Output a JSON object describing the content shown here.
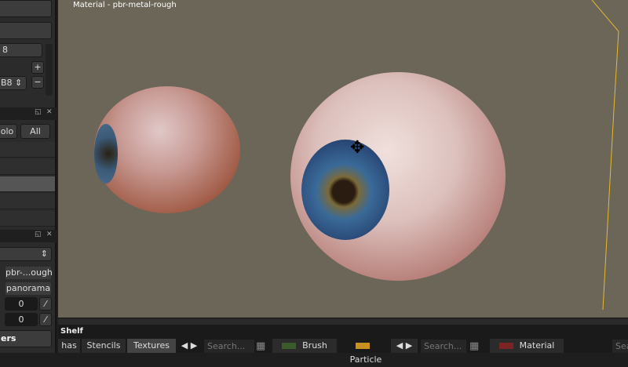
{
  "viewport": {
    "title": "Material - pbr-metal-rough"
  },
  "left_panel": {
    "format_value": "8",
    "format2_value": "B8",
    "solo_label": "olo",
    "all_label": "All",
    "shader_value": "pbr-...ough",
    "env_value": "panorama",
    "field1": "0",
    "field2": "0",
    "section_label": "ers"
  },
  "shelf": {
    "title": "Shelf",
    "tabs": [
      "has",
      "Stencils",
      "Textures"
    ],
    "search_placeholder": "Search...",
    "brush_label": "Brush",
    "particle_label": "Particle",
    "material_label": "Material",
    "search3": "Sea"
  },
  "colors": {
    "brush": "#3c5a2c",
    "particle": "#c8901c",
    "material": "#7a2424"
  }
}
